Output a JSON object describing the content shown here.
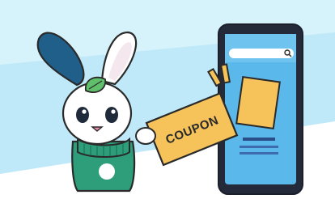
{
  "illustration": {
    "description_free": true,
    "coupon": {
      "label": "COUPON"
    },
    "phone": {
      "search_icon": "search-icon"
    },
    "colors": {
      "sky": "#cdeffa",
      "sky_band": "#9fdcf2",
      "phone_body": "#22293a",
      "phone_screen": "#57b5e8",
      "coupon_fill": "#f6c25a",
      "ticket_fill": "#f6c25a",
      "bunny_scarf": "#2e9e7a",
      "bunny_ear_dark": "#1f5f8a",
      "leaf": "#5fbf6a",
      "outline": "#2a2a2a"
    }
  }
}
